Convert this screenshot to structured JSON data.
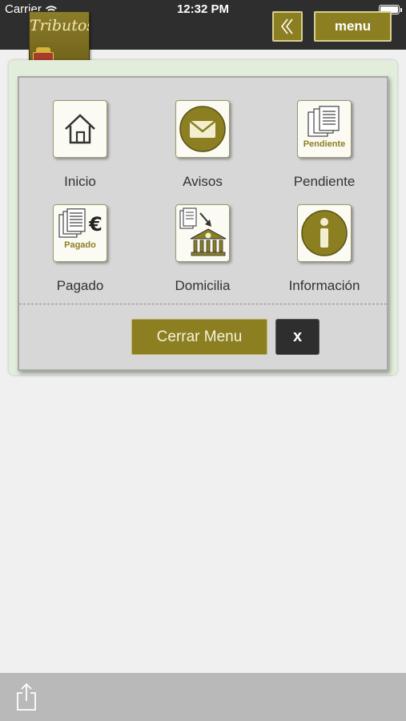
{
  "status": {
    "carrier": "Carrier",
    "time": "12:32 PM"
  },
  "header": {
    "logo_text": "Tributos",
    "menu_label": "menu",
    "back_icon": "double-chevron-left-icon"
  },
  "menu": {
    "items": [
      {
        "label": "Inicio",
        "icon": "home-icon"
      },
      {
        "label": "Avisos",
        "icon": "envelope-icon"
      },
      {
        "label": "Pendiente",
        "icon": "pending-documents-icon",
        "badge": "Pendiente"
      },
      {
        "label": "Pagado",
        "icon": "paid-documents-icon",
        "badge": "Pagado",
        "symbol": "€"
      },
      {
        "label": "Domicilia",
        "icon": "bank-transfer-icon",
        "symbol": "$"
      },
      {
        "label": "Información",
        "icon": "info-icon",
        "symbol": "i"
      }
    ],
    "close_label": "Cerrar Menu",
    "x_label": "x"
  },
  "toolbar": {
    "share_icon": "share-icon"
  },
  "colors": {
    "accent": "#8c7f22",
    "dark": "#2e2e2e",
    "panel": "#d7d7d7"
  }
}
